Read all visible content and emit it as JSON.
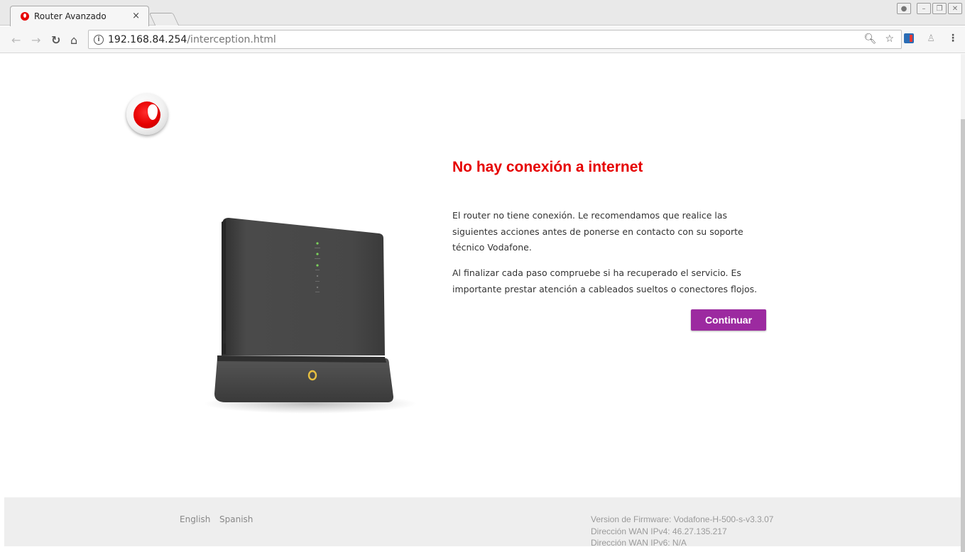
{
  "browser": {
    "tab_title": "Router Avanzado",
    "tab_close": "×",
    "url_host": "192.168.84.254",
    "url_path": "/interception.html",
    "info_glyph": "i",
    "icons": [
      "back-arrow-icon",
      "forward-arrow-icon",
      "reload-icon",
      "home-icon",
      "info-icon",
      "zoom-icon",
      "star-icon",
      "extension-icon",
      "user-icon",
      "menu-icon"
    ]
  },
  "page": {
    "title": "No hay conexión a internet",
    "paragraph1": "El router no tiene conexión. Le recomendamos que realice las siguientes acciones antes de ponerse en contacto con su soporte técnico Vodafone.",
    "paragraph2": "Al finalizar cada paso compruebe si ha recuperado el servicio. Es importante prestar atención a cableados sueltos o conectores flojos.",
    "continue_button": "Continuar",
    "accent_color": "#e60000",
    "button_color": "#9c2aa0"
  },
  "footer": {
    "languages": [
      "English",
      "Spanish"
    ],
    "firmware": "Version de Firmware: Vodafone-H-500-s-v3.3.07",
    "wan_ipv4": "Dirección WAN IPv4: 46.27.135.217",
    "wan_ipv6": "Dirección WAN IPv6: N/A"
  }
}
